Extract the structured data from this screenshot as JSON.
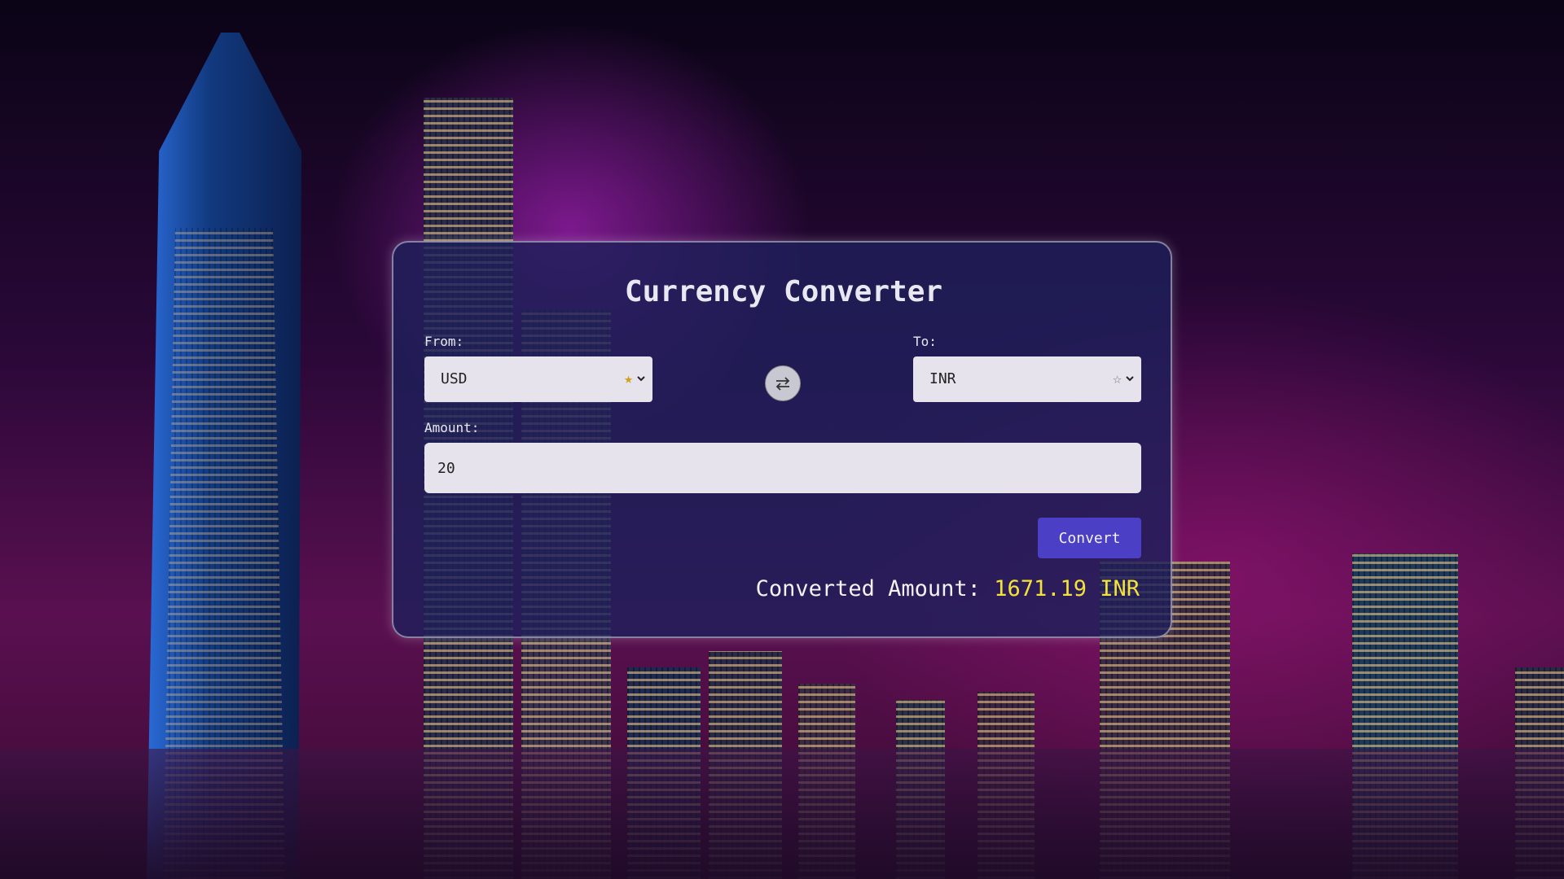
{
  "converter": {
    "title": "Currency Converter",
    "from_label": "From:",
    "from_value": "USD",
    "from_favorite": true,
    "to_label": "To:",
    "to_value": "INR",
    "to_favorite": false,
    "amount_label": "Amount:",
    "amount_value": "20",
    "convert_label": "Convert",
    "result_label": "Converted Amount:",
    "result_value": "1671.19 INR"
  },
  "icons": {
    "from_star": "star-filled-icon",
    "to_star": "star-outline-icon",
    "swap": "swap-arrows-icon",
    "dropdown": "chevron-down-icon"
  },
  "colors": {
    "accent_button": "#4b3fc6",
    "result_value": "#f2e23a",
    "favorite_star": "#d4a017",
    "panel": "#1e205a"
  }
}
